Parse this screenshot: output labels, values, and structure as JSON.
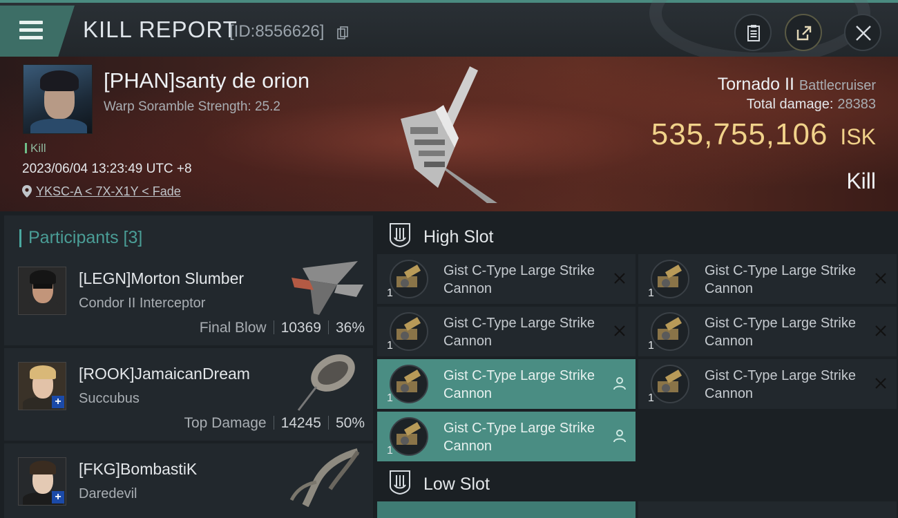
{
  "header": {
    "title": "KILL REPORT",
    "id_text": "[ID:8556626]"
  },
  "victim": {
    "name": "[PHAN]santy de orion",
    "scramble": "Warp Soramble Strength: 25.2",
    "tag": "Kill",
    "datetime": "2023/06/04 13:23:49 UTC +8",
    "location": "YKSC-A < 7X-X1Y < Fade",
    "ship": "Tornado II",
    "ship_class": "Battlecruiser",
    "damage_label": "Total damage:",
    "damage_value": "28383",
    "isk_value": "535,755,106",
    "isk_unit": "ISK",
    "result": "Kill"
  },
  "participants": {
    "label": "Participants [3]",
    "rows": [
      {
        "name": "[LEGN]Morton Slumber",
        "ship": "Condor II Interceptor",
        "tag": "Final Blow",
        "damage": "10369",
        "percent": "36%"
      },
      {
        "name": "[ROOK]JamaicanDream",
        "ship": "Succubus",
        "tag": "Top Damage",
        "damage": "14245",
        "percent": "50%"
      },
      {
        "name": "[FKG]BombastiK",
        "ship": "Daredevil",
        "tag": "",
        "damage": "",
        "percent": ""
      }
    ]
  },
  "slots": {
    "high_label": "High Slot",
    "low_label": "Low Slot",
    "high_modules": [
      {
        "name": "Gist C-Type Large Strike Cannon",
        "qty": "1",
        "status": "destroyed"
      },
      {
        "name": "Gist C-Type Large Strike Cannon",
        "qty": "1",
        "status": "destroyed"
      },
      {
        "name": "Gist C-Type Large Strike Cannon",
        "qty": "1",
        "status": "destroyed"
      },
      {
        "name": "Gist C-Type Large Strike Cannon",
        "qty": "1",
        "status": "destroyed"
      },
      {
        "name": "Gist C-Type Large Strike Cannon",
        "qty": "1",
        "status": "dropped"
      },
      {
        "name": "Gist C-Type Large Strike Cannon",
        "qty": "1",
        "status": "destroyed"
      },
      {
        "name": "Gist C-Type Large Strike Cannon",
        "qty": "1",
        "status": "dropped"
      }
    ]
  },
  "colors": {
    "accent": "#4a8d83",
    "isk": "#f1d28a",
    "participants_label": "#4a9d96"
  },
  "icons": [
    "menu-icon",
    "copy-icon",
    "report-icon",
    "share-icon",
    "close-icon",
    "location-pin-icon",
    "high-slot-icon",
    "low-slot-icon",
    "destroyed-x-icon",
    "dropped-person-icon"
  ]
}
